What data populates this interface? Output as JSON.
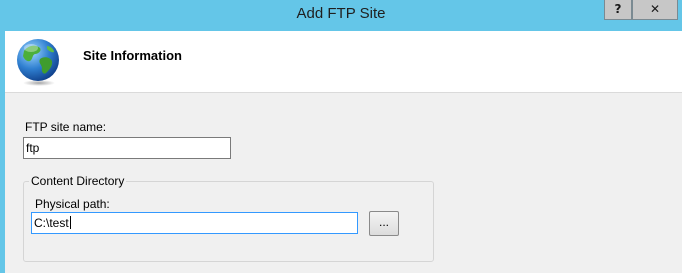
{
  "window": {
    "title": "Add FTP Site",
    "help_label": "?",
    "close_label": "✕"
  },
  "header": {
    "title": "Site Information",
    "icon": "globe-icon"
  },
  "form": {
    "site_name_label": "FTP site name:",
    "site_name_value": "ftp",
    "content_directory_legend": "Content Directory",
    "physical_path_label": "Physical path:",
    "physical_path_value": "C:\\test",
    "browse_label": "..."
  },
  "colors": {
    "titlebar": "#64c6e8",
    "focus_border": "#3399ff"
  }
}
